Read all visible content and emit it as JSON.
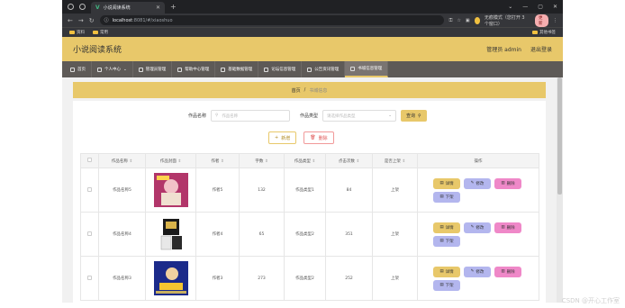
{
  "browser": {
    "tab_title": "小说阅读系统",
    "url_host": "localhost",
    "url_path": ":8081/#/xiaoshuo",
    "profile_label": "无痕模式（您打开 3 个窗口）",
    "update_label": "更新",
    "bookmarks": [
      "资料",
      "常用"
    ],
    "bookmarks_right": "其他书签"
  },
  "app": {
    "title": "小说阅读系统",
    "admin_label": "管理员 admin",
    "logout_label": "退出登录"
  },
  "nav": [
    {
      "label": "首页"
    },
    {
      "label": "个人中心"
    },
    {
      "label": "管理员管理"
    },
    {
      "label": "帮助中心管理"
    },
    {
      "label": "基础数据管理"
    },
    {
      "label": "论坛信息管理"
    },
    {
      "label": "公告资讯管理"
    },
    {
      "label": "书城信息管理"
    }
  ],
  "breadcrumb": {
    "home": "首页",
    "sep": "/",
    "current": "书城信息"
  },
  "search": {
    "name_label": "作品名称",
    "name_placeholder": "作品名称",
    "type_label": "作品类型",
    "type_placeholder": "请选择作品类型",
    "query_label": "查询"
  },
  "actions": {
    "add_label": "新增",
    "delete_label": "删除"
  },
  "table": {
    "headers": [
      "作品名称",
      "作品封面",
      "作者",
      "字数",
      "作品类型",
      "点击次数",
      "是否上架",
      "操作"
    ],
    "rows": [
      {
        "name": "作品名称5",
        "author": "作者5",
        "words": "132",
        "type": "作品类型1",
        "clicks": "84",
        "status": "上架"
      },
      {
        "name": "作品名称4",
        "author": "作者4",
        "words": "65",
        "type": "作品类型2",
        "clicks": "351",
        "status": "上架"
      },
      {
        "name": "作品名称3",
        "author": "作者3",
        "words": "273",
        "type": "作品类型2",
        "clicks": "252",
        "status": "上架"
      }
    ],
    "op_labels": {
      "detail": "详情",
      "edit": "修改",
      "remove": "删除",
      "down": "下架"
    }
  },
  "watermark": "CSDN @开心工作室"
}
